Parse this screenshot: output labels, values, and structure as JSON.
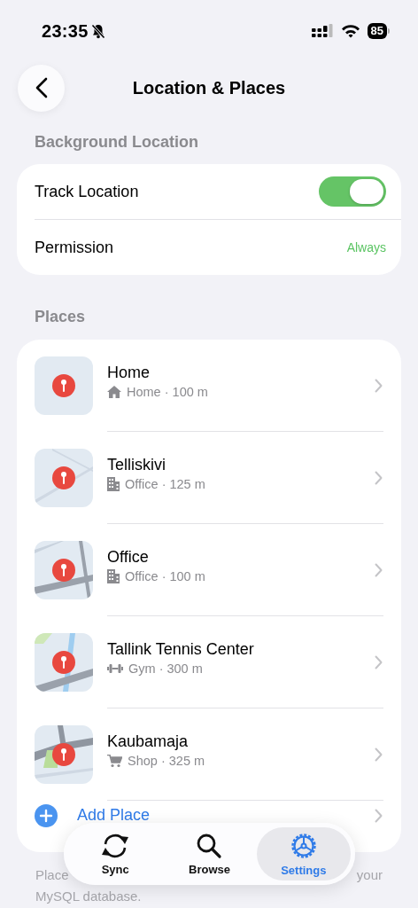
{
  "status_bar": {
    "time": "23:35",
    "battery": "85"
  },
  "header": {
    "title": "Location & Places"
  },
  "background_location": {
    "heading": "Background Location",
    "rows": [
      {
        "kind": "toggle",
        "label": "Track Location",
        "on": true
      },
      {
        "kind": "value",
        "label": "Permission",
        "value": "Always"
      }
    ]
  },
  "places": {
    "heading": "Places",
    "items": [
      {
        "name": "Home",
        "kind": "house",
        "detail": "Home · 100 m"
      },
      {
        "name": "Telliskivi",
        "kind": "building",
        "detail": "Office · 125 m"
      },
      {
        "name": "Office",
        "kind": "building",
        "detail": "Office · 100 m"
      },
      {
        "name": "Tallink Tennis Center",
        "kind": "dumbbell",
        "detail": "Gym · 300 m"
      },
      {
        "name": "Kaubamaja",
        "kind": "cart",
        "detail": "Shop · 325 m"
      }
    ],
    "add_label": "Add Place"
  },
  "footer": {
    "line_1_start": "Place",
    "line_1_end": "your",
    "line_2": "MySQL database."
  },
  "tabs": [
    {
      "label": "Sync",
      "selected": false
    },
    {
      "label": "Browse",
      "selected": false
    },
    {
      "label": "Settings",
      "selected": true
    }
  ]
}
